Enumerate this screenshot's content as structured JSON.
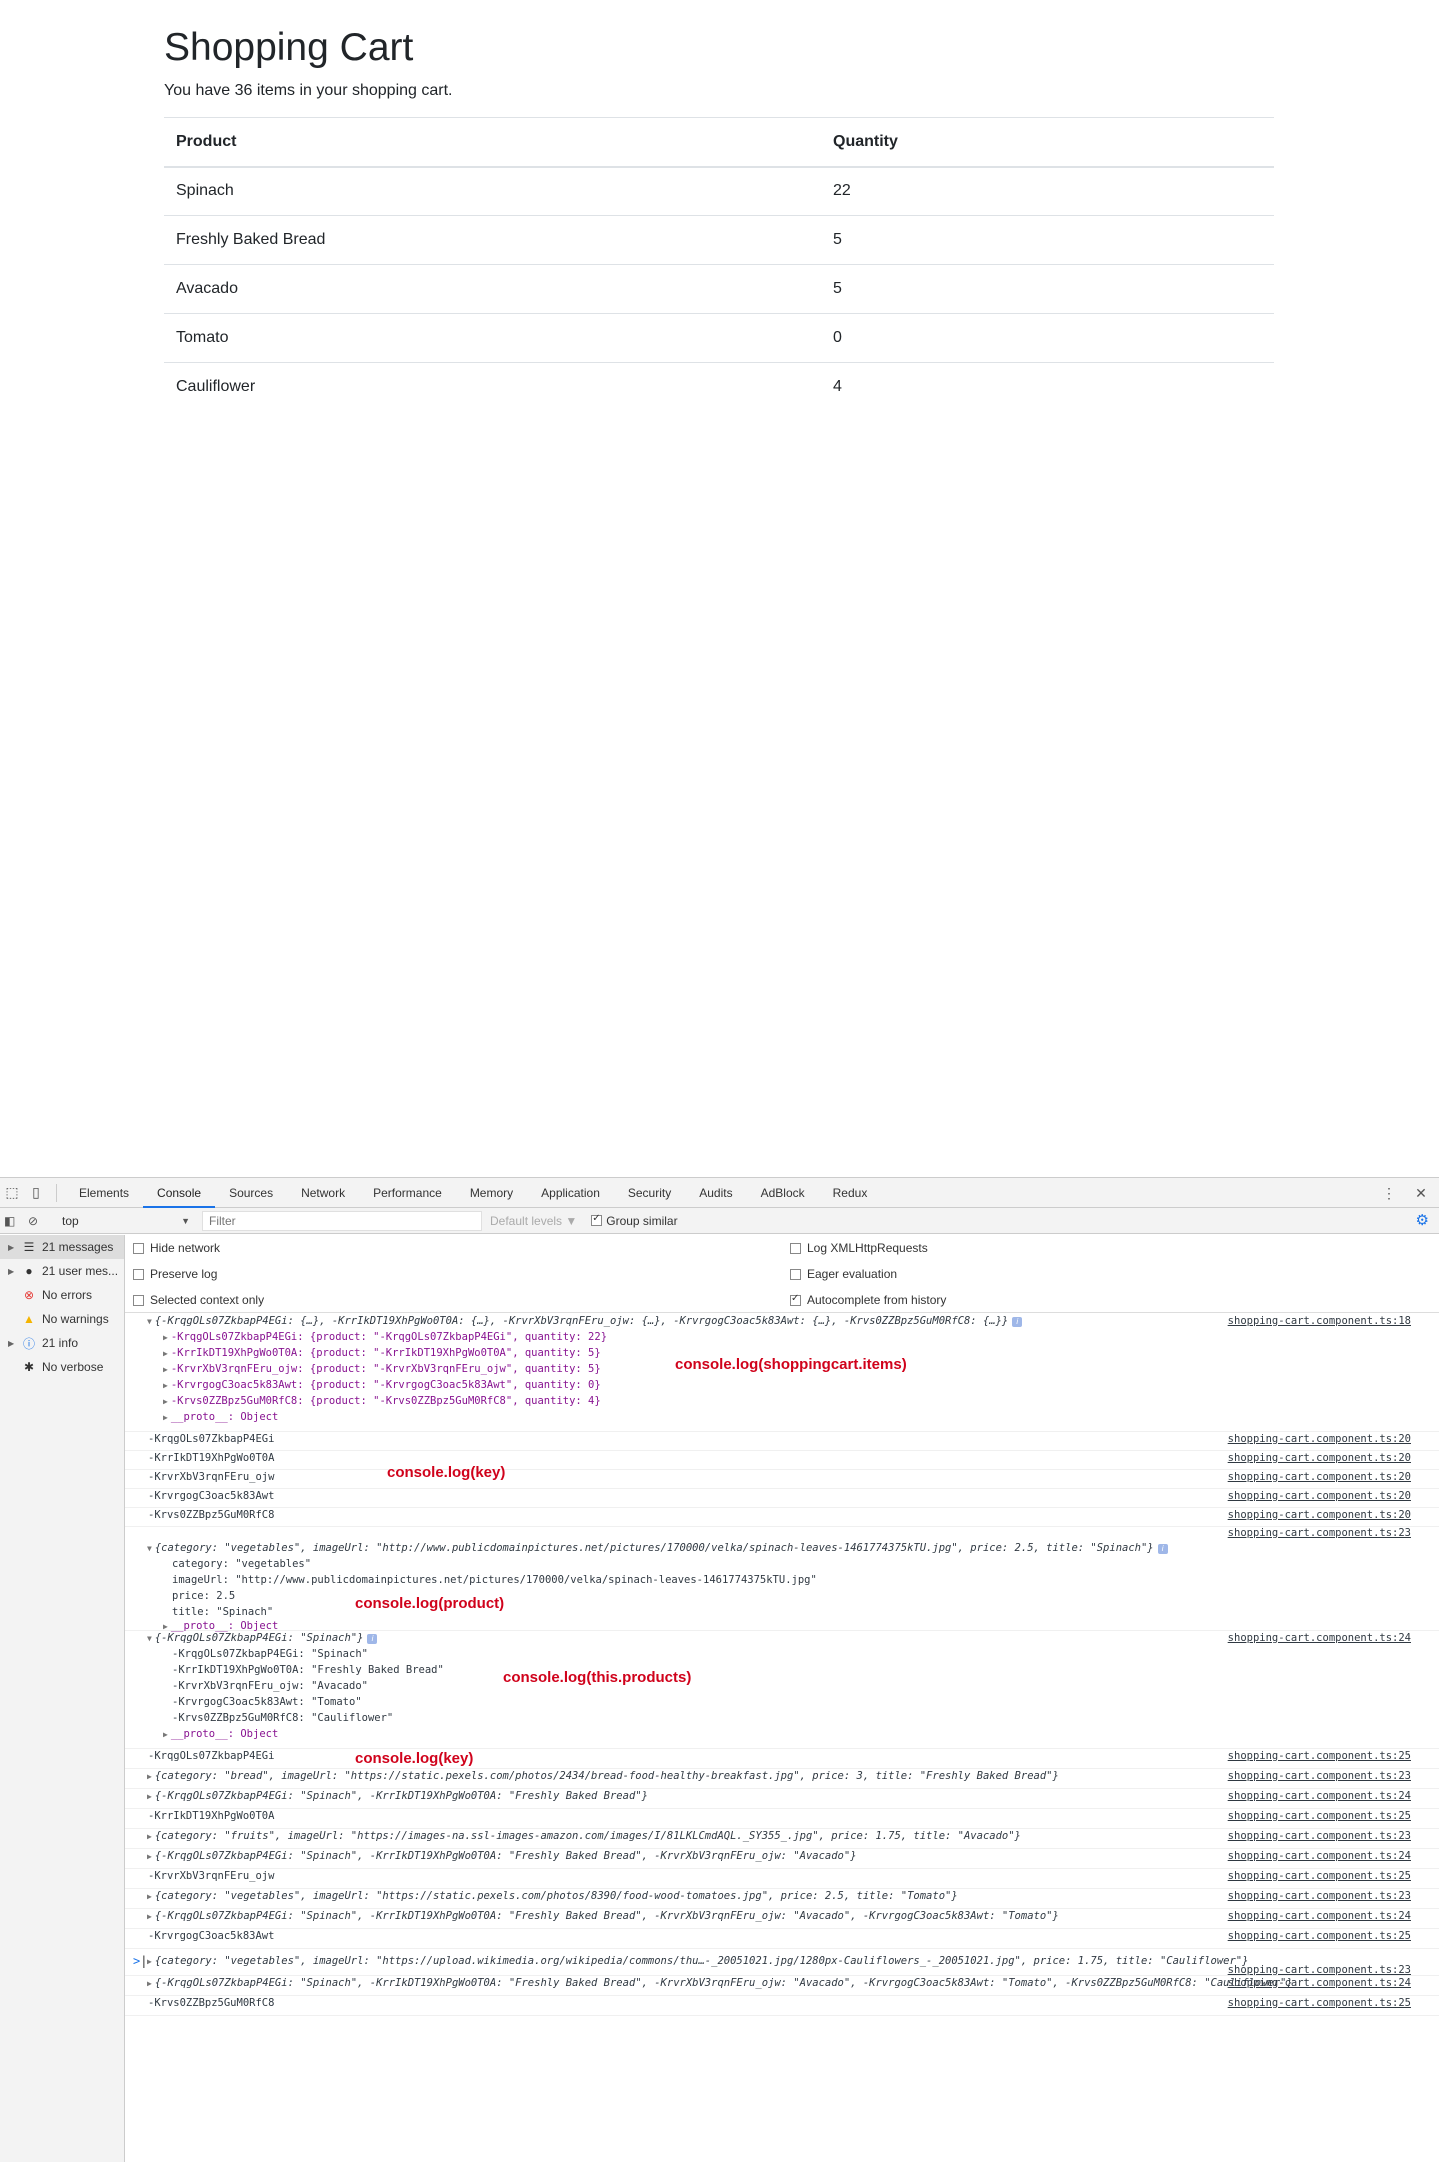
{
  "page": {
    "title": "Shopping Cart",
    "subtitle": "You have 36 items in your shopping cart.",
    "table": {
      "headers": [
        "Product",
        "Quantity"
      ],
      "rows": [
        {
          "product": "Spinach",
          "quantity": "22"
        },
        {
          "product": "Freshly Baked Bread",
          "quantity": "5"
        },
        {
          "product": "Avacado",
          "quantity": "5"
        },
        {
          "product": "Tomato",
          "quantity": "0"
        },
        {
          "product": "Cauliflower",
          "quantity": "4"
        }
      ]
    }
  },
  "devtools": {
    "tabs": [
      "Elements",
      "Console",
      "Sources",
      "Network",
      "Performance",
      "Memory",
      "Application",
      "Security",
      "Audits",
      "AdBlock",
      "Redux"
    ],
    "active_tab": "Console",
    "toolbar": {
      "context": "top",
      "filter_placeholder": "Filter",
      "levels": "Default levels ▼",
      "group_similar": "Group similar"
    },
    "sidebar": [
      {
        "label": "21 messages",
        "icon": "list-icon"
      },
      {
        "label": "21 user mes...",
        "icon": "user-icon"
      },
      {
        "label": "No errors",
        "icon": "error-icon"
      },
      {
        "label": "No warnings",
        "icon": "warning-icon"
      },
      {
        "label": "21 info",
        "icon": "info-icon"
      },
      {
        "label": "No verbose",
        "icon": "bug-icon"
      }
    ],
    "settings": {
      "hide_network": "Hide network",
      "preserve_log": "Preserve log",
      "selected_context": "Selected context only",
      "log_xhr": "Log XMLHttpRequests",
      "eager_eval": "Eager evaluation",
      "autocomplete": "Autocomplete from history"
    },
    "annotations": {
      "items": "console.log(shoppingcart.items)",
      "key1": "console.log(key)",
      "product": "console.log(product)",
      "products": "console.log(this.products)",
      "key2": "console.log(key)"
    }
  },
  "console": {
    "items_obj": "{-KrqgOLs07ZkbapP4EGi: {…}, -KrrIkDT19XhPgWo0T0A: {…}, -KrvrXbV3rqnFEru_ojw: {…}, -KrvrgogC3oac5k83Awt: {…}, -Krvs0ZZBpz5GuM0RfC8: {…}}",
    "items_src": "shopping-cart.component.ts:18",
    "items_lines": [
      "-KrqgOLs07ZkbapP4EGi: {product: \"-KrqgOLs07ZkbapP4EGi\", quantity: 22}",
      "-KrrIkDT19XhPgWo0T0A: {product: \"-KrrIkDT19XhPgWo0T0A\", quantity: 5}",
      "-KrvrXbV3rqnFEru_ojw: {product: \"-KrvrXbV3rqnFEru_ojw\", quantity: 5}",
      "-KrvrgogC3oac5k83Awt: {product: \"-KrvrgogC3oac5k83Awt\", quantity: 0}",
      "-Krvs0ZZBpz5GuM0RfC8: {product: \"-Krvs0ZZBpz5GuM0RfC8\", quantity: 4}"
    ],
    "proto": "__proto__: Object",
    "keys": [
      "-KrqgOLs07ZkbapP4EGi",
      "-KrrIkDT19XhPgWo0T0A",
      "-KrvrXbV3rqnFEru_ojw",
      "-KrvrgogC3oac5k83Awt",
      "-Krvs0ZZBpz5GuM0RfC8"
    ],
    "src20": "shopping-cart.component.ts:20",
    "src23": "shopping-cart.component.ts:23",
    "src24": "shopping-cart.component.ts:24",
    "src25": "shopping-cart.component.ts:25",
    "product_obj": "{category: \"vegetables\", imageUrl: \"http://www.publicdomainpictures.net/pictures/170000/velka/spinach-leaves-1461774375kTU.jpg\", price: 2.5, title: \"Spinach\"}",
    "product_lines": [
      "category: \"vegetables\"",
      "imageUrl: \"http://www.publicdomainpictures.net/pictures/170000/velka/spinach-leaves-1461774375kTU.jpg\"",
      "price: 2.5",
      "title: \"Spinach\""
    ],
    "products_obj": "{-KrqgOLs07ZkbapP4EGi: \"Spinach\"}",
    "products_lines": [
      "-KrqgOLs07ZkbapP4EGi: \"Spinach\"",
      "-KrrIkDT19XhPgWo0T0A: \"Freshly Baked Bread\"",
      "-KrvrXbV3rqnFEru_ojw: \"Avacado\"",
      "-KrvrgogC3oac5k83Awt: \"Tomato\"",
      "-Krvs0ZZBpz5GuM0RfC8: \"Cauliflower\""
    ],
    "tail": [
      {
        "text": "-KrqgOLs07ZkbapP4EGi",
        "src": "shopping-cart.component.ts:25",
        "expand": false
      },
      {
        "text": "{category: \"bread\", imageUrl: \"https://static.pexels.com/photos/2434/bread-food-healthy-breakfast.jpg\", price: 3, title: \"Freshly Baked Bread\"}",
        "src": "shopping-cart.component.ts:23",
        "expand": true
      },
      {
        "text": "{-KrqgOLs07ZkbapP4EGi: \"Spinach\", -KrrIkDT19XhPgWo0T0A: \"Freshly Baked Bread\"}",
        "src": "shopping-cart.component.ts:24",
        "expand": true
      },
      {
        "text": "-KrrIkDT19XhPgWo0T0A",
        "src": "shopping-cart.component.ts:25",
        "expand": false
      },
      {
        "text": "{category: \"fruits\", imageUrl: \"https://images-na.ssl-images-amazon.com/images/I/81LKLCmdAQL._SY355_.jpg\", price: 1.75, title: \"Avacado\"}",
        "src": "shopping-cart.component.ts:23",
        "expand": true
      },
      {
        "text": "{-KrqgOLs07ZkbapP4EGi: \"Spinach\", -KrrIkDT19XhPgWo0T0A: \"Freshly Baked Bread\", -KrvrXbV3rqnFEru_ojw: \"Avacado\"}",
        "src": "shopping-cart.component.ts:24",
        "expand": true
      },
      {
        "text": "-KrvrXbV3rqnFEru_ojw",
        "src": "shopping-cart.component.ts:25",
        "expand": false
      },
      {
        "text": "{category: \"vegetables\", imageUrl: \"https://static.pexels.com/photos/8390/food-wood-tomatoes.jpg\", price: 2.5, title: \"Tomato\"}",
        "src": "shopping-cart.component.ts:23",
        "expand": true
      },
      {
        "text": "{-KrqgOLs07ZkbapP4EGi: \"Spinach\", -KrrIkDT19XhPgWo0T0A: \"Freshly Baked Bread\", -KrvrXbV3rqnFEru_ojw: \"Avacado\", -KrvrgogC3oac5k83Awt: \"Tomato\"}",
        "src": "shopping-cart.component.ts:24",
        "expand": true
      },
      {
        "text": "-KrvrgogC3oac5k83Awt",
        "src": "shopping-cart.component.ts:25",
        "expand": false
      },
      {
        "text": "{category: \"vegetables\", imageUrl: \"https://upload.wikimedia.org/wikipedia/commons/thu…-_20051021.jpg/1280px-Cauliflowers_-_20051021.jpg\", price: 1.75, title: \"Cauliflower\"}",
        "src": "shopping-cart.component.ts:23",
        "expand": true
      },
      {
        "text": "{-KrqgOLs07ZkbapP4EGi: \"Spinach\", -KrrIkDT19XhPgWo0T0A: \"Freshly Baked Bread\", -KrvrXbV3rqnFEru_ojw: \"Avacado\", -KrvrgogC3oac5k83Awt: \"Tomato\", -Krvs0ZZBpz5GuM0RfC8: \"Cauliflower\"}",
        "src": "shopping-cart.component.ts:24",
        "expand": true
      },
      {
        "text": "-Krvs0ZZBpz5GuM0RfC8",
        "src": "shopping-cart.component.ts:25",
        "expand": false
      }
    ],
    "prompt": ">"
  }
}
